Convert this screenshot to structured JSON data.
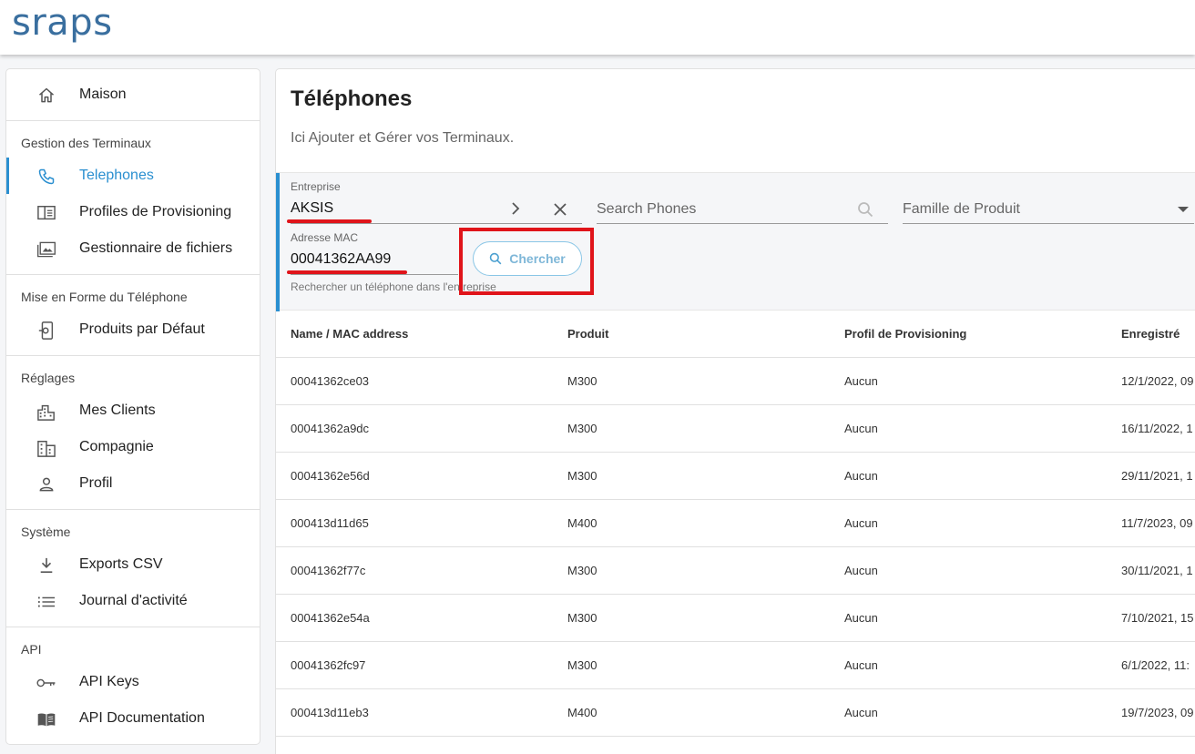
{
  "app": {
    "logo_text": "sraps"
  },
  "sidebar": {
    "home": {
      "label": "Maison",
      "icon": "home-icon"
    },
    "sections": [
      {
        "title": "Gestion des Terminaux",
        "items": [
          {
            "label": "Telephones",
            "icon": "phone-icon",
            "active": true
          },
          {
            "label": "Profiles de Provisioning",
            "icon": "profile-card-icon"
          },
          {
            "label": "Gestionnaire de fichiers",
            "icon": "file-manager-icon"
          }
        ]
      },
      {
        "title": "Mise en Forme du Téléphone",
        "items": [
          {
            "label": "Produits par Défaut",
            "icon": "device-settings-icon"
          }
        ]
      },
      {
        "title": "Réglages",
        "items": [
          {
            "label": "Mes Clients",
            "icon": "city-icon"
          },
          {
            "label": "Compagnie",
            "icon": "building-icon"
          },
          {
            "label": "Profil",
            "icon": "person-icon"
          }
        ]
      },
      {
        "title": "Système",
        "items": [
          {
            "label": "Exports CSV",
            "icon": "download-icon"
          },
          {
            "label": "Journal d'activité",
            "icon": "list-icon"
          }
        ]
      },
      {
        "title": "API",
        "items": [
          {
            "label": "API Keys",
            "icon": "key-icon"
          },
          {
            "label": "API Documentation",
            "icon": "book-icon"
          }
        ]
      }
    ]
  },
  "main": {
    "title": "Téléphones",
    "subtitle": "Ici Ajouter et Gérer vos Terminaux.",
    "filters": {
      "company": {
        "label": "Entreprise",
        "value": "AKSIS"
      },
      "search": {
        "placeholder": "Search Phones"
      },
      "family": {
        "placeholder": "Famille de Produit"
      },
      "mac": {
        "label": "Adresse MAC",
        "value": "00041362AA99",
        "hint": "Rechercher un téléphone dans l'entreprise"
      },
      "search_button": "Chercher"
    },
    "table": {
      "columns": [
        "Name / MAC address",
        "Produit",
        "Profil de Provisioning",
        "Enregistré"
      ],
      "rows": [
        [
          "00041362ce03",
          "M300",
          "Aucun",
          "12/1/2022, 09"
        ],
        [
          "00041362a9dc",
          "M300",
          "Aucun",
          "16/11/2022, 1"
        ],
        [
          "00041362e56d",
          "M300",
          "Aucun",
          "29/11/2021, 1"
        ],
        [
          "000413d11d65",
          "M400",
          "Aucun",
          "11/7/2023, 09"
        ],
        [
          "00041362f77c",
          "M300",
          "Aucun",
          "30/11/2021, 1"
        ],
        [
          "00041362e54a",
          "M300",
          "Aucun",
          "7/10/2021, 15"
        ],
        [
          "00041362fc97",
          "M300",
          "Aucun",
          "6/1/2022, 11:"
        ],
        [
          "000413d11eb3",
          "M400",
          "Aucun",
          "19/7/2023, 09"
        ]
      ]
    }
  },
  "colors": {
    "accent": "#2a8fd0",
    "annotation": "#e0141a",
    "logo": "#3a6f9f"
  }
}
